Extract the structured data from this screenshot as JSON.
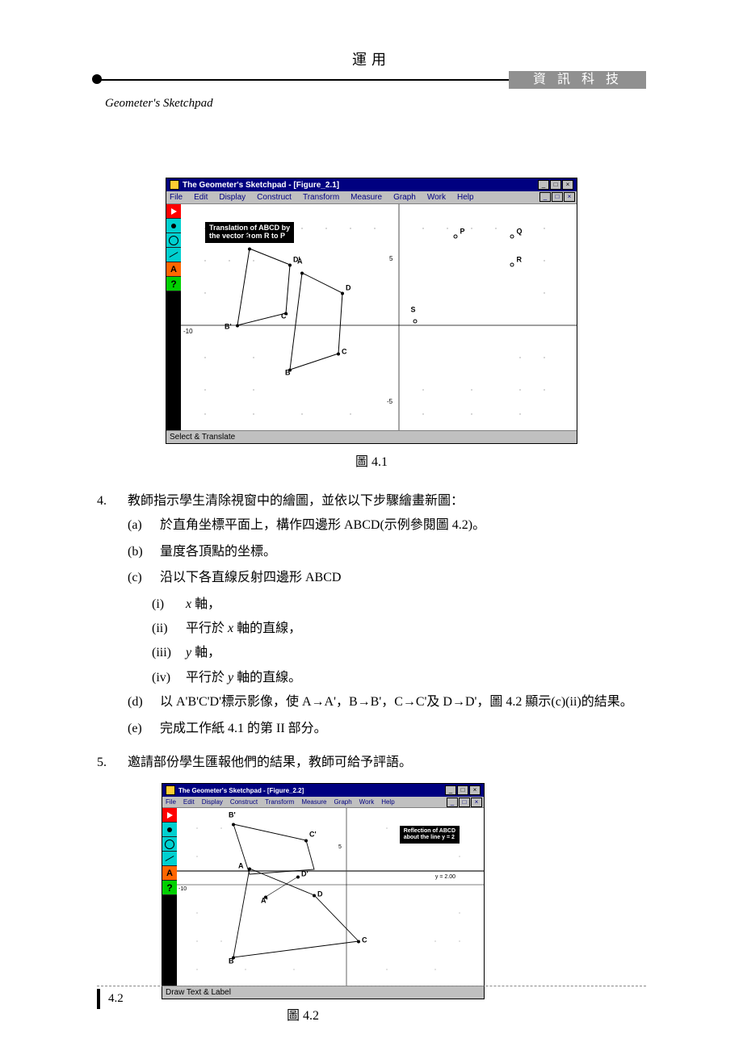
{
  "header": {
    "main": "運用",
    "badge": "資訊科技",
    "subtitle": "Geometer's Sketchpad"
  },
  "fig1": {
    "title": "The Geometer's Sketchpad - [Figure_2.1]",
    "menu": [
      "File",
      "Edit",
      "Display",
      "Construct",
      "Transform",
      "Measure",
      "Graph",
      "Work",
      "Help"
    ],
    "textbox_l1": "Translation of ABCD by",
    "textbox_l2": "the vector from R to P",
    "ticks": {
      "x_neg": "-10",
      "y_pos": "5",
      "y_neg": "-5"
    },
    "pts": {
      "A": "A",
      "B": "B",
      "C": "C",
      "D": "D",
      "Ap": "A'",
      "Bp": "B'",
      "Cp": "C'",
      "Dp": "D'",
      "P": "P",
      "Q": "Q",
      "R": "R",
      "S": "S"
    },
    "status": "Select & Translate",
    "caption": "圖 4.1"
  },
  "step4": {
    "num": "4.",
    "intro": "教師指示學生清除視窗中的繪圖，並依以下步驟繪畫新圖：",
    "a": {
      "lbl": "(a)",
      "txt": "於直角坐標平面上，構作四邊形 ABCD(示例參閱圖 4.2)。"
    },
    "b": {
      "lbl": "(b)",
      "txt": "量度各頂點的坐標。"
    },
    "c": {
      "lbl": "(c)",
      "txt": "沿以下各直線反射四邊形 ABCD",
      "i": {
        "lbl": "(i)",
        "pre": "x",
        "post": " 軸，"
      },
      "ii": {
        "lbl": "(ii)",
        "pre": "平行於 ",
        "var": "x",
        "post": " 軸的直線，"
      },
      "iii": {
        "lbl": "(iii)",
        "pre": "y",
        "post": " 軸，"
      },
      "iv": {
        "lbl": "(iv)",
        "pre": "平行於 ",
        "var": "y",
        "post": " 軸的直線。"
      }
    },
    "d": {
      "lbl": "(d)",
      "txt": "以 A'B'C'D'標示影像，使 A→A'，B→B'，C→C'及 D→D'，圖 4.2 顯示(c)(ii)的結果。"
    },
    "e": {
      "lbl": "(e)",
      "txt": "完成工作紙 4.1 的第 II 部分。"
    }
  },
  "step5": {
    "num": "5.",
    "txt": "邀請部份學生匯報他們的結果，教師可給予評語。"
  },
  "fig2": {
    "title": "The Geometer's Sketchpad - [Figure_2.2]",
    "menu": [
      "File",
      "Edit",
      "Display",
      "Construct",
      "Transform",
      "Measure",
      "Graph",
      "Work",
      "Help"
    ],
    "textbox_l1": "Reflection of ABCD",
    "textbox_l2": "about the line y = 2",
    "yval": "y = 2.00",
    "ticks": {
      "x_neg": "-10",
      "y_pos": "5"
    },
    "pts": {
      "A": "A",
      "B": "B",
      "C": "C",
      "D": "D",
      "Ap": "A'",
      "Bp": "B'",
      "Cp": "C'",
      "Dp": "D'"
    },
    "status": "Draw Text & Label",
    "caption": "圖 4.2"
  },
  "footer": {
    "page": "4.2"
  }
}
